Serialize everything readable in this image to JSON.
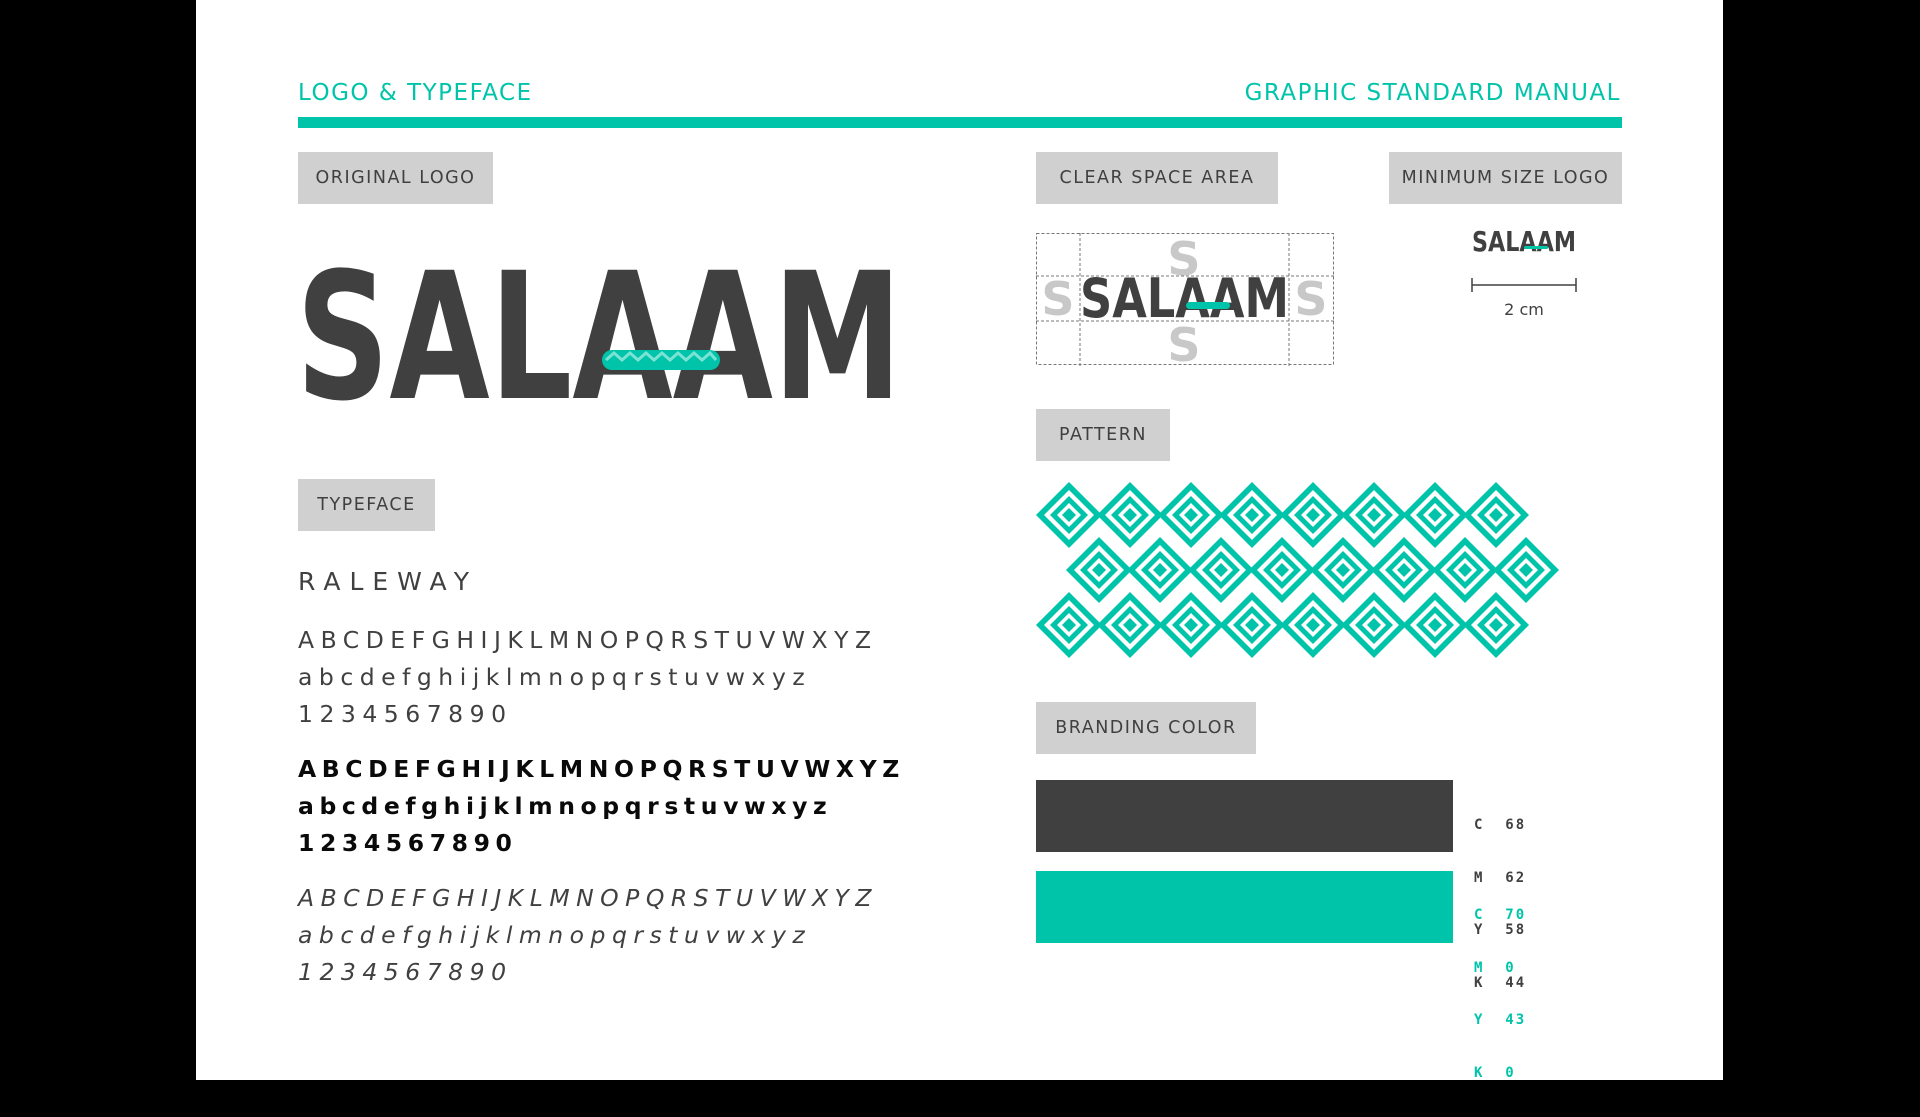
{
  "header": {
    "left_title": "LOGO & TYPEFACE",
    "right_title": "GRAPHIC STANDARD MANUAL"
  },
  "sections": {
    "original_logo": "ORIGINAL LOGO",
    "clear_space": "CLEAR SPACE AREA",
    "minimum_size": "MINIMUM SIZE LOGO",
    "pattern": "PATTERN",
    "typeface": "TYPEFACE",
    "branding_color": "BRANDING COLOR"
  },
  "logo": {
    "wordmark": "SALAAM",
    "clear_space_marker": "S"
  },
  "minimum_size": {
    "measure": "2 cm"
  },
  "typeface": {
    "name": "RALEWAY",
    "regular": [
      "ABCDEFGHIJKLMNOPQRSTUVWXYZ",
      "abcdefghijklmnopqrstuvwxyz",
      "1234567890"
    ],
    "bold": [
      "ABCDEFGHIJKLMNOPQRSTUVWXYZ",
      "abcdefghijklmnopqrstuvwxyz",
      "1234567890"
    ],
    "italic": [
      "ABCDEFGHIJKLMNOPQRSTUVWXYZ",
      "abcdefghijklmnopqrstuvwxyz",
      "1234567890"
    ]
  },
  "colors": {
    "accent": "#00c4aa",
    "dark": "#404041",
    "swatches": [
      {
        "hex": "#404041",
        "cmyk": [
          [
            "C",
            "68"
          ],
          [
            "M",
            "62"
          ],
          [
            "Y",
            "58"
          ],
          [
            "K",
            "44"
          ]
        ]
      },
      {
        "hex": "#00c4aa",
        "cmyk": [
          [
            "C",
            "70"
          ],
          [
            "M",
            "0"
          ],
          [
            "Y",
            "43"
          ],
          [
            "K",
            "0"
          ]
        ]
      }
    ]
  }
}
